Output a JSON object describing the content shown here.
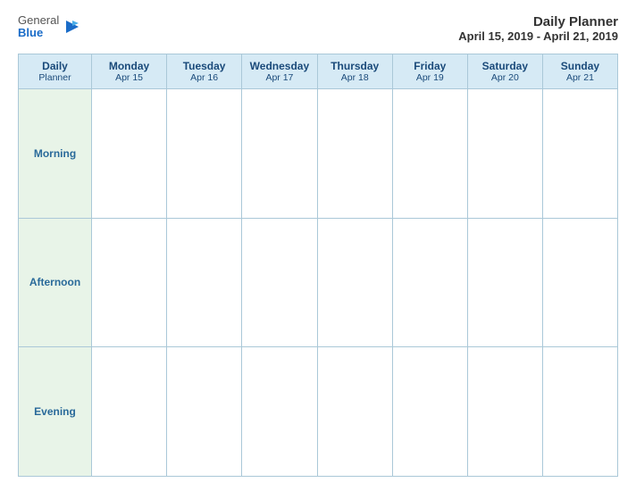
{
  "header": {
    "logo": {
      "general": "General",
      "blue": "Blue",
      "icon": "▶"
    },
    "title": "Daily Planner",
    "date_range": "April 15, 2019 - April 21, 2019"
  },
  "table": {
    "header_label": "Daily\nPlanner",
    "header_label_line1": "Daily",
    "header_label_line2": "Planner",
    "days": [
      {
        "name": "Monday",
        "date": "Apr 15"
      },
      {
        "name": "Tuesday",
        "date": "Apr 16"
      },
      {
        "name": "Wednesday",
        "date": "Apr 17"
      },
      {
        "name": "Thursday",
        "date": "Apr 18"
      },
      {
        "name": "Friday",
        "date": "Apr 19"
      },
      {
        "name": "Saturday",
        "date": "Apr 20"
      },
      {
        "name": "Sunday",
        "date": "Apr 21"
      }
    ],
    "rows": [
      {
        "label": "Morning"
      },
      {
        "label": "Afternoon"
      },
      {
        "label": "Evening"
      }
    ]
  }
}
